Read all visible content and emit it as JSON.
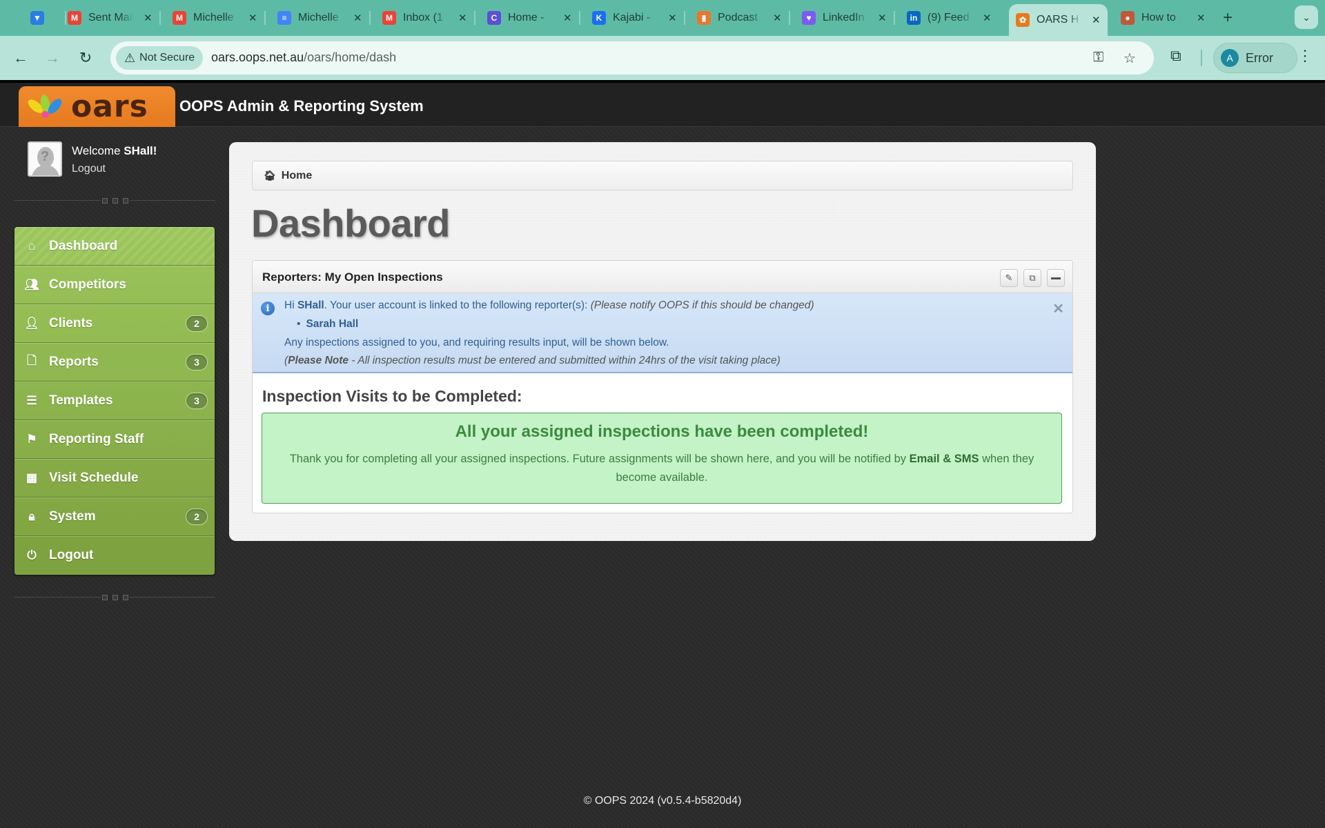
{
  "browser": {
    "tabs": [
      {
        "title": "",
        "icon": "diamond-icon",
        "color": "#2a7de1"
      },
      {
        "title": "Sent Mail",
        "icon": "gmail-icon",
        "color": "#ea4335"
      },
      {
        "title": "Michelle",
        "icon": "gmail-icon",
        "color": "#ea4335"
      },
      {
        "title": "Michelle",
        "icon": "docs-icon",
        "color": "#4285f4"
      },
      {
        "title": "Inbox (1",
        "icon": "gmail-icon",
        "color": "#ea4335"
      },
      {
        "title": "Home -",
        "icon": "canva-icon",
        "color": "#5a4fd6"
      },
      {
        "title": "Kajabi -",
        "icon": "kajabi-icon",
        "color": "#1b6ef3"
      },
      {
        "title": "Podcast",
        "icon": "trello-icon",
        "color": "#e8772e"
      },
      {
        "title": "LinkedIn",
        "icon": "heart-chat-icon",
        "color": "#7b5cf0"
      },
      {
        "title": "(9) Feed",
        "icon": "linkedin-icon",
        "color": "#0a66c2"
      },
      {
        "title": "OARS H",
        "icon": "oars-icon",
        "color": "#e67a1e",
        "active": true
      },
      {
        "title": "How to",
        "icon": "page-icon",
        "color": "#c0583a"
      }
    ],
    "security_label": "Not Secure",
    "url_host": "oars.oops.net.au",
    "url_path": "/oars/home/dash",
    "profile_initial": "A",
    "profile_status": "Error"
  },
  "app": {
    "logo_text": "oars",
    "title": "OOPS Admin & Reporting System"
  },
  "user": {
    "welcome_prefix": "Welcome ",
    "username": "SHall!",
    "logout_label": "Logout"
  },
  "nav": {
    "items": [
      {
        "label": "Dashboard",
        "icon": "home-icon",
        "badge": null,
        "active": true
      },
      {
        "label": "Competitors",
        "icon": "users-icon",
        "badge": null
      },
      {
        "label": "Clients",
        "icon": "user-icon",
        "badge": "2"
      },
      {
        "label": "Reports",
        "icon": "document-icon",
        "badge": "3"
      },
      {
        "label": "Templates",
        "icon": "list-icon",
        "badge": "3"
      },
      {
        "label": "Reporting Staff",
        "icon": "flag-icon",
        "badge": null
      },
      {
        "label": "Visit Schedule",
        "icon": "calendar-icon",
        "badge": null
      },
      {
        "label": "System",
        "icon": "lock-icon",
        "badge": "2"
      },
      {
        "label": "Logout",
        "icon": "power-icon",
        "badge": null
      }
    ],
    "colors": {
      "top": "#9cc75c",
      "bottom": "#7ea23f"
    }
  },
  "main": {
    "breadcrumb": "Home",
    "page_title": "Dashboard",
    "box": {
      "title": "Reporters: My Open Inspections",
      "info": {
        "hi": "Hi ",
        "username": "SHall",
        "linked_text": ". Your user account is linked to the following reporter(s): ",
        "notify_text": "(Please notify OOPS if this should be changed)",
        "reporters": [
          "Sarah Hall"
        ],
        "assigned_text": "Any inspections assigned to you, and requiring results input, will be shown below.",
        "note_open": "(",
        "note_label": "Please Note",
        "note_text": " - All inspection results must be entered and submitted within 24hrs of the visit taking place)"
      },
      "section_title": "Inspection Visits to be Completed:",
      "success": {
        "heading": "All your assigned inspections have been completed!",
        "text_before": "Thank you for completing all your assigned inspections. Future assignments will be shown here, and you will be notified by ",
        "text_bold": "Email & SMS",
        "text_after": " when they become available."
      }
    }
  },
  "footer": "© OOPS 2024 (v0.5.4-b5820d4)"
}
